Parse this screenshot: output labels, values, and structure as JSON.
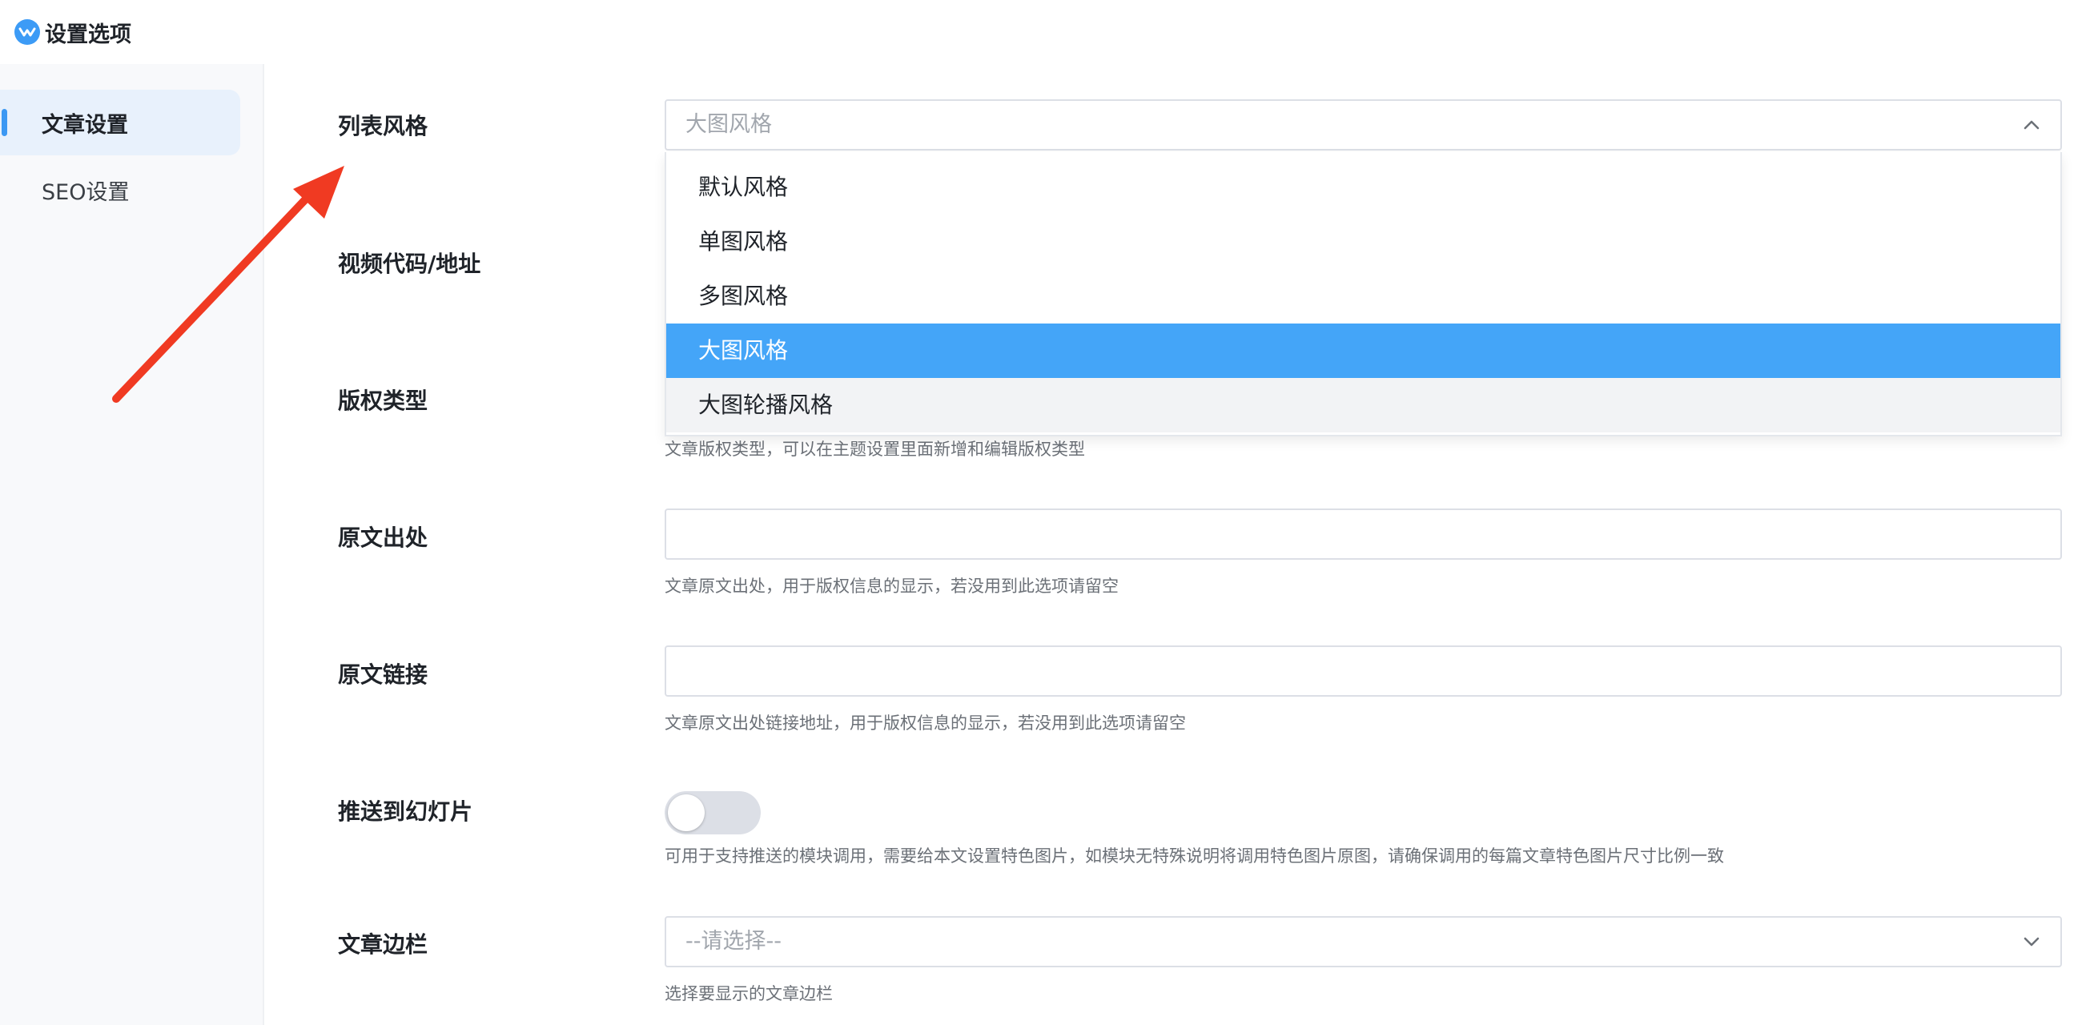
{
  "app": {
    "title": "设置选项"
  },
  "sidebar": {
    "items": [
      {
        "label": "文章设置"
      },
      {
        "label": "SEO设置"
      }
    ]
  },
  "form": {
    "list_style": {
      "label": "列表风格",
      "placeholder": "大图风格",
      "options": [
        "默认风格",
        "单图风格",
        "多图风格",
        "大图风格",
        "大图轮播风格"
      ],
      "selected": "大图风格",
      "hovered": "大图轮播风格"
    },
    "video": {
      "label": "视频代码/地址"
    },
    "copyright": {
      "label": "版权类型",
      "help": "文章版权类型，可以在主题设置里面新增和编辑版权类型"
    },
    "source": {
      "label": "原文出处",
      "value": "",
      "help": "文章原文出处，用于版权信息的显示，若没用到此选项请留空"
    },
    "source_link": {
      "label": "原文链接",
      "value": "",
      "help": "文章原文出处链接地址，用于版权信息的显示，若没用到此选项请留空"
    },
    "slideshow": {
      "label": "推送到幻灯片",
      "checked": false,
      "help": "可用于支持推送的模块调用，需要给本文设置特色图片，如模块无特殊说明将调用特色图片原图，请确保调用的每篇文章特色图片尺寸比例一致"
    },
    "sidebar_select": {
      "label": "文章边栏",
      "placeholder": "--请选择--",
      "help": "选择要显示的文章边栏"
    }
  },
  "colors": {
    "accent": "#44a5f8",
    "annotation_arrow": "#f03a22"
  },
  "icons": {
    "logo": "brand-logo-icon",
    "dropdown_open": "chevron-up-icon",
    "dropdown_closed": "chevron-down-icon"
  }
}
